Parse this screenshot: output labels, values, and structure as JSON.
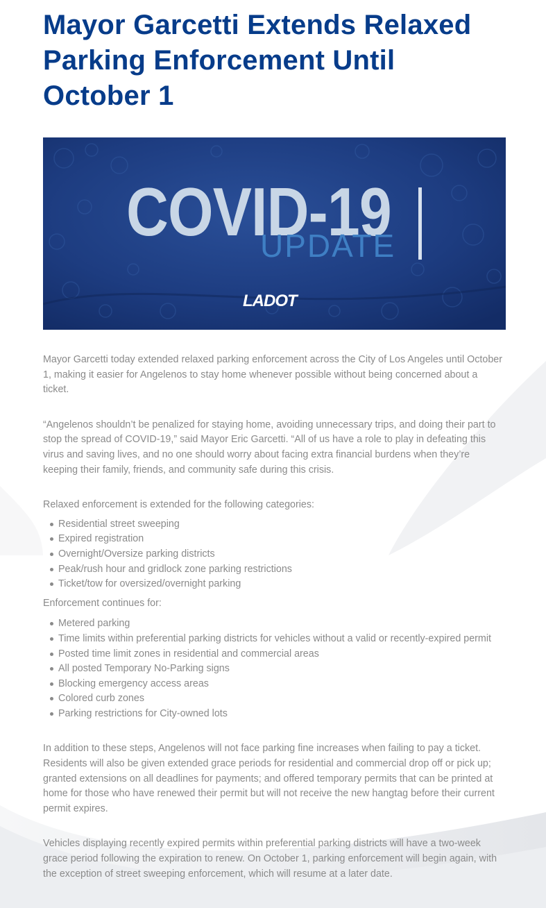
{
  "article": {
    "title": "Mayor Garcetti Extends Relaxed Parking Enforcement Until October 1",
    "hero": {
      "headline": "COVID-19",
      "subheadline": "UPDATE",
      "logo_text": "LADOT"
    },
    "paragraphs": {
      "intro": "Mayor Garcetti today extended relaxed parking enforcement across the City of Los Angeles until October 1, making it easier for Angelenos to stay home whenever possible without being concerned about a ticket.",
      "quote": "“Angelenos shouldn’t be penalized for staying home, avoiding unnecessary trips, and doing their part to stop the spread of COVID-19,” said Mayor Eric Garcetti. “All of us have a role to play in defeating this virus and saving lives, and no one should worry about facing extra financial burdens when they’re keeping their family, friends, and community safe during this crisis.",
      "relaxed_heading": "Relaxed enforcement is extended for the following categories:",
      "continues_heading": "Enforcement continues for:",
      "additional": "In addition to these steps, Angelenos will not face parking fine increases when failing to pay a ticket. Residents will also be given extended grace periods for residential and commercial drop off or pick up; granted extensions on all deadlines for payments; and offered temporary permits that can be printed at home for those who have renewed their permit but will not receive the new hangtag before their current permit expires.",
      "closing": "Vehicles displaying recently expired permits within preferential parking districts will have a two-week grace period following the expiration to renew. On October 1, parking enforcement will begin again, with the exception of street sweeping enforcement, which will resume at a later date."
    },
    "relaxed_items": [
      "Residential street sweeping",
      "Expired registration",
      "Overnight/Oversize parking districts",
      "Peak/rush hour and gridlock zone parking restrictions",
      "Ticket/tow for oversized/overnight parking"
    ],
    "continues_items": [
      "Metered parking",
      "Time limits within preferential parking districts for vehicles without a valid or recently-expired permit",
      "Posted time limit zones in residential and commercial areas",
      "All posted Temporary No-Parking signs",
      "Blocking emergency access areas",
      "Colored curb zones",
      "Parking restrictions for City-owned lots"
    ]
  },
  "colors": {
    "title": "#073c8a",
    "body_text": "#8a8a8a",
    "hero_background": "#1c3a7c",
    "hero_headline": "#c8d6e6",
    "hero_subheadline": "#3f7fc4"
  }
}
